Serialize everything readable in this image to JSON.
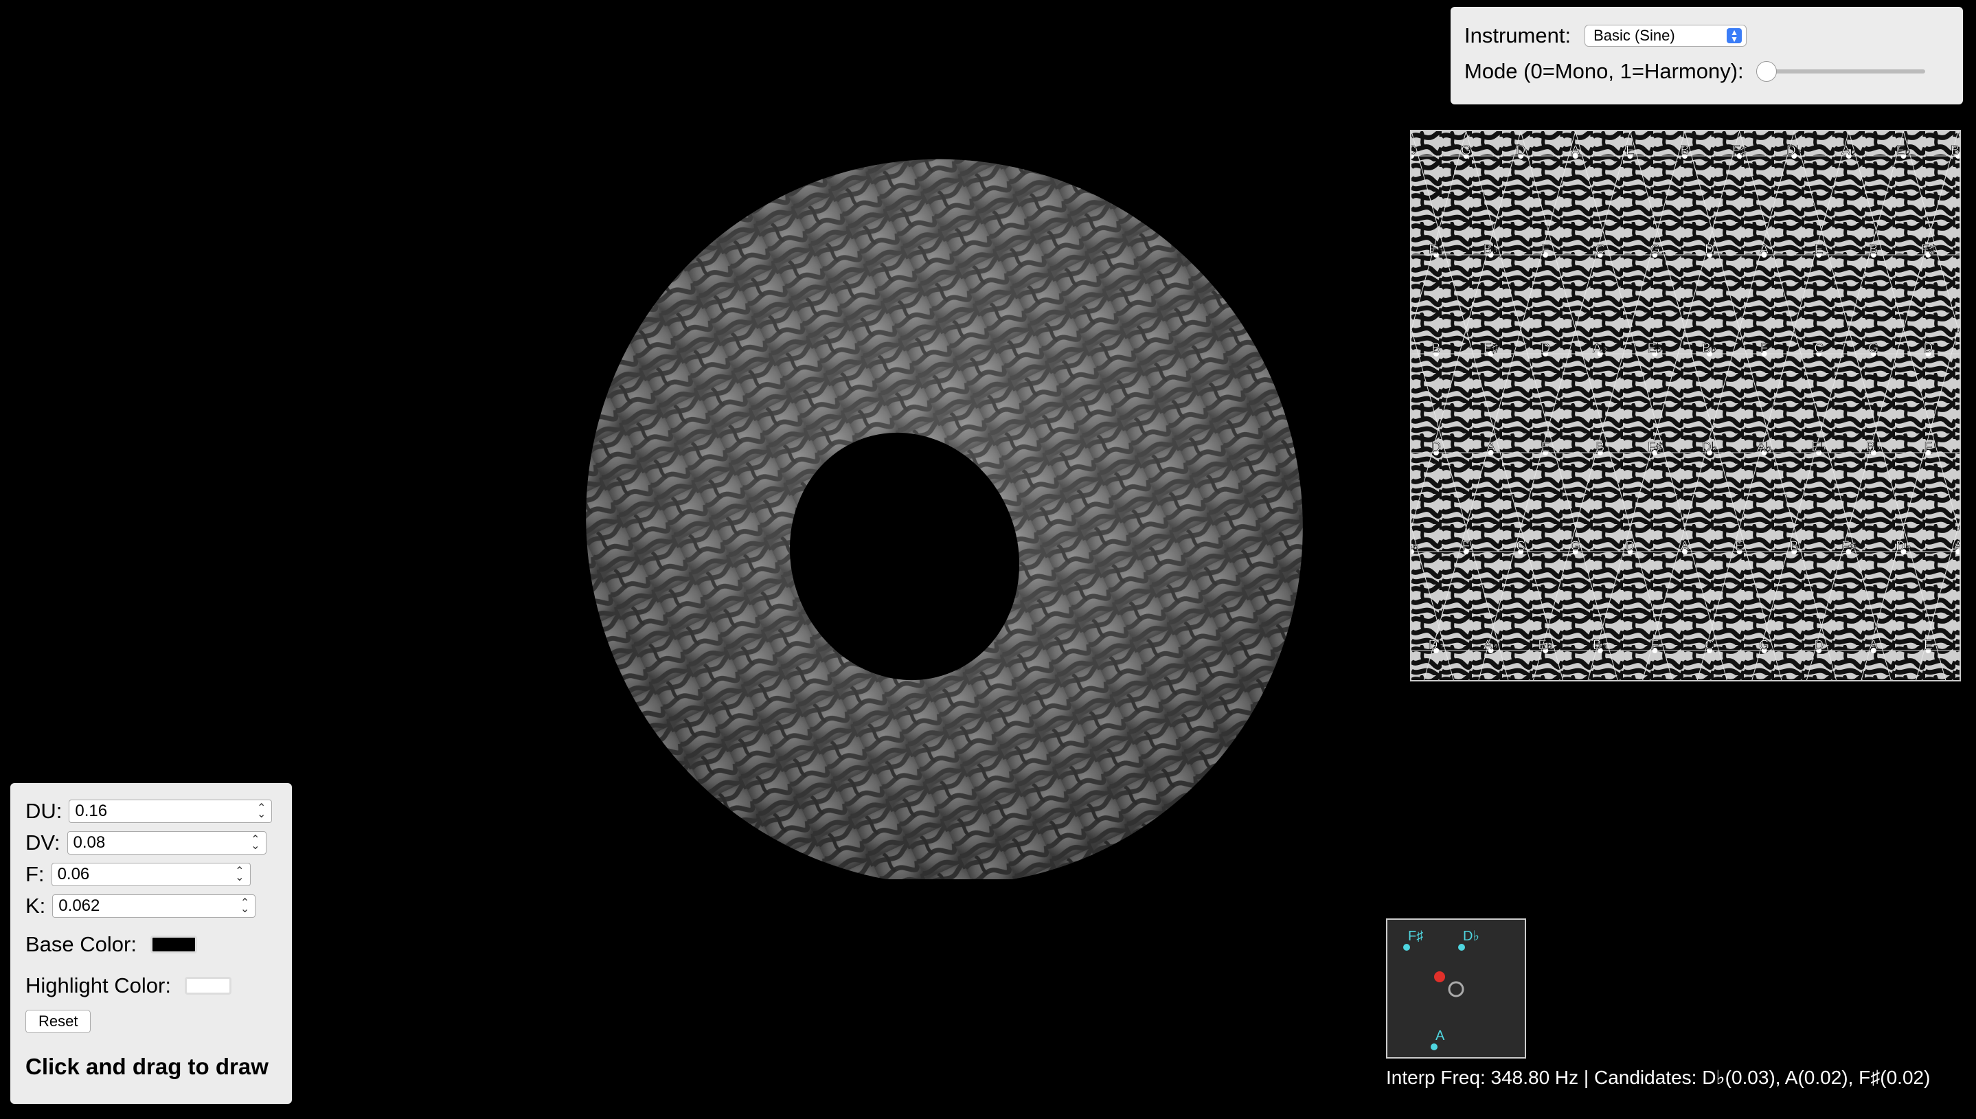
{
  "params": {
    "du_label": "DU:",
    "du_value": "0.16",
    "dv_label": "DV:",
    "dv_value": "0.08",
    "f_label": "F:",
    "f_value": "0.06",
    "k_label": "K:",
    "k_value": "0.062",
    "base_color_label": "Base Color:",
    "base_color": "#000000",
    "highlight_color_label": "Highlight Color:",
    "highlight_color": "#ffffff",
    "reset_label": "Reset",
    "hint": "Click and drag to draw"
  },
  "controls": {
    "instrument_label": "Instrument:",
    "instrument_value": "Basic (Sine)",
    "mode_label": "Mode (0=Mono, 1=Harmony):",
    "mode_value": 0
  },
  "note_grid": {
    "rows": [
      [
        "C",
        "G",
        "D",
        "A",
        "E",
        "B",
        "F♯",
        "D♭",
        "A♭",
        "E♭",
        "B♭"
      ],
      [
        "E♭",
        "B♭",
        "F",
        "C",
        "G",
        "D",
        "A",
        "E",
        "B",
        "F♯"
      ],
      [
        "B",
        "F♯",
        "D",
        "A♭",
        "E♭",
        "B♭",
        "F",
        "C",
        "G",
        "D"
      ],
      [
        "D",
        "A",
        "E",
        "B",
        "F♯",
        "D♭",
        "A♭",
        "E♭",
        "B♭",
        "F"
      ],
      [
        "B♭",
        "F",
        "C",
        "G",
        "D",
        "A",
        "E",
        "B",
        "F♯",
        "D♭",
        "A"
      ],
      [
        "D♭",
        "A♭",
        "E♭",
        "B♭",
        "F",
        "C",
        "G",
        "D",
        "A",
        "E"
      ]
    ]
  },
  "mini_map": {
    "nodes": [
      {
        "label": "F♯"
      },
      {
        "label": "D♭"
      },
      {
        "label": "A"
      }
    ],
    "accent_color": "#4fd6e0",
    "cursor_color": "#e0302a"
  },
  "status": {
    "text": "Interp Freq: 348.80 Hz | Candidates: D♭(0.03), A(0.02), F♯(0.02)"
  }
}
